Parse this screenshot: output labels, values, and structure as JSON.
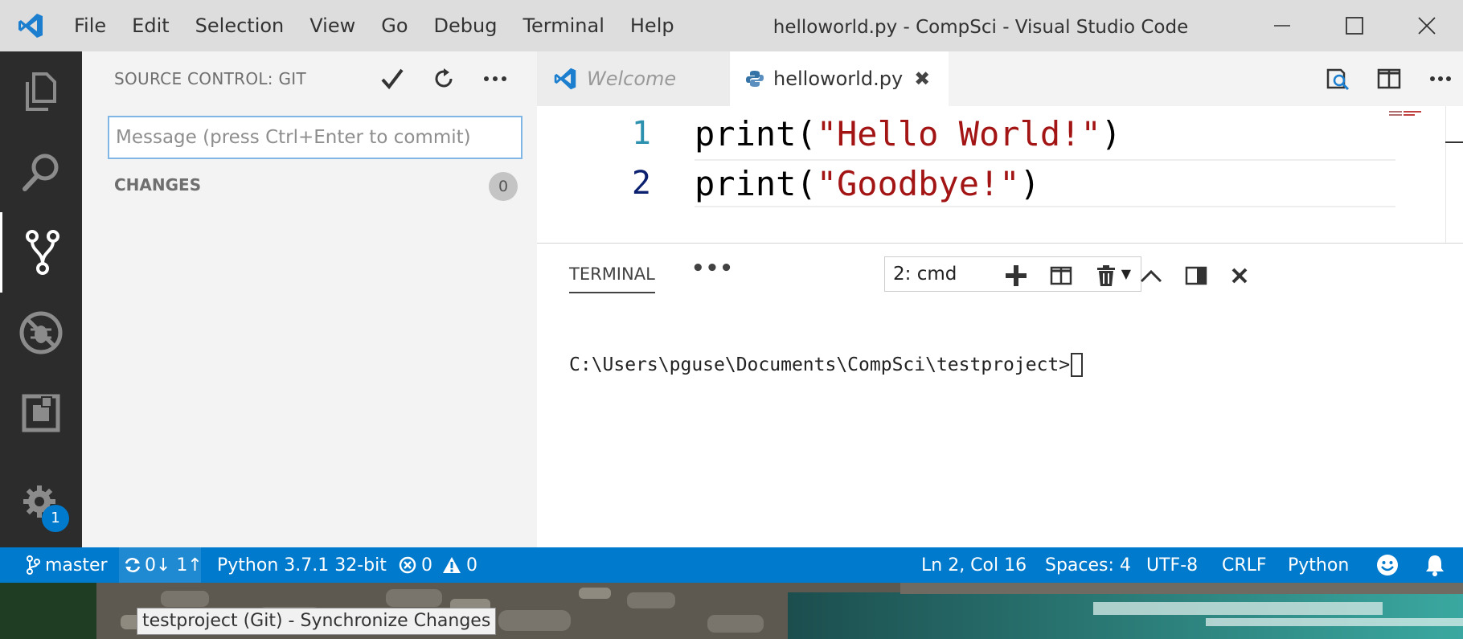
{
  "window": {
    "title": "helloworld.py - CompSci - Visual Studio Code",
    "app_icon": "vscode-logo-icon",
    "controls": [
      "minimize-icon",
      "maximize-icon",
      "close-icon"
    ]
  },
  "menu": [
    "File",
    "Edit",
    "Selection",
    "View",
    "Go",
    "Debug",
    "Terminal",
    "Help"
  ],
  "activity_bar": {
    "items": [
      "explorer-icon",
      "search-icon",
      "source-control-icon",
      "debug-icon",
      "extensions-icon"
    ],
    "active": "source-control-icon",
    "settings_icon": "gear-icon",
    "settings_badge": "1",
    "accent_color": "#007acc"
  },
  "sidebar": {
    "title": "SOURCE CONTROL: GIT",
    "actions": [
      "commit-check-icon",
      "refresh-icon",
      "more-icon"
    ],
    "commit_placeholder": "Message (press Ctrl+Enter to commit)",
    "commit_value": "",
    "changes_label": "CHANGES",
    "changes_count": "0"
  },
  "tabs": [
    {
      "label": "Welcome",
      "icon": "vscode-logo-icon",
      "active": false
    },
    {
      "label": "helloworld.py",
      "icon": "python-icon",
      "active": true,
      "close": "✖"
    }
  ],
  "editor_actions": [
    "open-preview-icon",
    "split-editor-icon",
    "more-icon"
  ],
  "editor": {
    "lines": [
      {
        "number": "1",
        "fn": "print(",
        "str": "\"Hello World!\"",
        "end": ")"
      },
      {
        "number": "2",
        "fn": "print(",
        "str": "\"Goodbye!\"",
        "end": ")"
      }
    ],
    "string_color": "#a31515"
  },
  "panel": {
    "title": "TERMINAL",
    "more": "•••",
    "terminal_select": "2: cmd",
    "actions": [
      "plus-icon",
      "split-terminal-icon",
      "trash-icon",
      "chevron-up-icon",
      "toggle-panel-icon",
      "close-icon"
    ],
    "output": "C:\\Users\\pguse\\Documents\\CompSci\\testproject>"
  },
  "statusbar": {
    "branch": "master",
    "sync": "0↓ 1↑",
    "interpreter": "Python 3.7.1 32-bit",
    "errors": "0",
    "warnings": "0",
    "position": "Ln 2, Col 16",
    "spaces": "Spaces: 4",
    "encoding": "UTF-8",
    "eol": "CRLF",
    "language": "Python",
    "icons": [
      "branch-icon",
      "sync-icon",
      "error-icon",
      "warning-icon",
      "smiley-icon",
      "bell-icon"
    ],
    "background": "#007acc"
  },
  "tooltip": "testproject (Git) - Synchronize Changes"
}
